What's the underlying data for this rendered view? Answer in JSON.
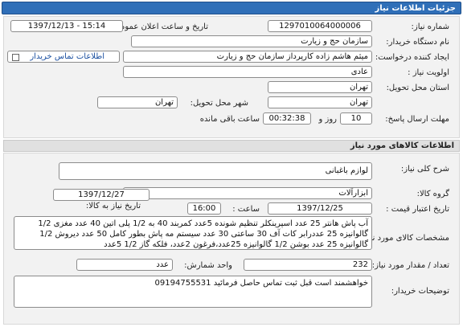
{
  "header": {
    "title": "جزئیات اطلاعات نیاز"
  },
  "info": {
    "need_number_label": "شماره نیاز:",
    "need_number": "1297010064000006",
    "announce_label": "تاریخ و ساعت اعلان عمومی:",
    "announce_value": "1397/12/13 - 15:14",
    "buyer_label": "نام دستگاه خریدار:",
    "buyer_value": "سازمان حج و زیارت",
    "creator_label": "ایجاد کننده درخواست:",
    "creator_value": "میثم هاشم زاده کارپرداز سازمان حج و زیارت",
    "contact_link": "اطلاعات تماس خریدار",
    "priority_label": "اولویت نیاز :",
    "priority_value": "عادی",
    "province_label": "استان محل تحویل:",
    "province_value": "تهران",
    "city_label": "شهر محل تحویل:",
    "city_value": "تهران",
    "deadline_label": "مهلت ارسال پاسخ:",
    "deadline_days": "10",
    "deadline_days_unit": "روز و",
    "deadline_time": "00:32:38",
    "deadline_time_suffix": "ساعت باقی مانده"
  },
  "goods": {
    "section_title": "اطلاعات کالاهای مورد نیاز",
    "summary_label": "شرح کلی نیاز:",
    "summary_value": "لوازم باغبانی",
    "group_label": "گروه کالا:",
    "group_value": "ابزارآلات",
    "need_date_label": "تاریخ نیاز به کالا:",
    "need_date_value": "1397/12/27",
    "validity_label": "تاریخ اعتبار قیمت :",
    "validity_date": "1397/12/25",
    "validity_time_label": "ساعت :",
    "validity_time": "16:00",
    "spec_label": "مشخصات کالای مورد نیاز:",
    "spec_value": "آب پاش هانتر 25 عدد اسپرینکلر تنظیم شونده 5عدد کمربند 40 به 1/2 پلی اتین 40 عدد مغزی 1/2 گالوانیزه 25 عددرابر کات آف 30 ساعتی 30 عدد سیستم مه پاش بطور کامل 50 عدد دیروش 1/2 گالوانیزه 25 عدد بوشن 1/2 گالوانیزه 25عدد،فرغون 2عدد، فلکه گاز 1/2 5عدد",
    "qty_label": "تعداد / مقدار مورد نیاز:",
    "qty_value": "232",
    "unit_label": "واحد شمارش:",
    "unit_value": "عدد",
    "notes_label": "توضیحات خریدار:",
    "notes_value": "خواهشمند است قبل ثبت تماس حاصل فرمائید 09194755531"
  }
}
